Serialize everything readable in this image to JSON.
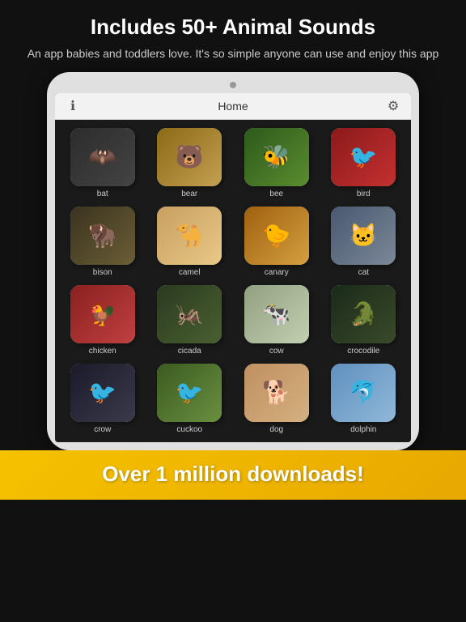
{
  "header": {
    "title": "Includes 50+ Animal Sounds",
    "subtitle": "An app babies and toddlers love.  It's so simple anyone can use and enjoy this app"
  },
  "app": {
    "screen_title": "Home",
    "info_icon": "ℹ",
    "settings_icon": "⚙"
  },
  "animals": [
    {
      "name": "bat",
      "emoji": "🦇",
      "bg_class": "bat-bg"
    },
    {
      "name": "bear",
      "emoji": "🐻",
      "bg_class": "bear-bg"
    },
    {
      "name": "bee",
      "emoji": "🐝",
      "bg_class": "bee-bg"
    },
    {
      "name": "bird",
      "emoji": "🐦",
      "bg_class": "bird-bg"
    },
    {
      "name": "bison",
      "emoji": "🦬",
      "bg_class": "bison-bg"
    },
    {
      "name": "camel",
      "emoji": "🐪",
      "bg_class": "camel-bg"
    },
    {
      "name": "canary",
      "emoji": "🐤",
      "bg_class": "canary-bg"
    },
    {
      "name": "cat",
      "emoji": "🐱",
      "bg_class": "cat-bg"
    },
    {
      "name": "chicken",
      "emoji": "🐓",
      "bg_class": "chicken-bg"
    },
    {
      "name": "cicada",
      "emoji": "🦗",
      "bg_class": "cicada-bg"
    },
    {
      "name": "cow",
      "emoji": "🐄",
      "bg_class": "cow-bg"
    },
    {
      "name": "crocodile",
      "emoji": "🐊",
      "bg_class": "croc-bg"
    },
    {
      "name": "crow",
      "emoji": "🐦",
      "bg_class": "bird2-bg"
    },
    {
      "name": "cuckoo",
      "emoji": "🐦",
      "bg_class": "bird3-bg"
    },
    {
      "name": "dog",
      "emoji": "🐕",
      "bg_class": "dog-bg"
    },
    {
      "name": "dolphin",
      "emoji": "🐬",
      "bg_class": "whale-bg"
    }
  ],
  "banner": {
    "text": "Over 1 million downloads!"
  }
}
